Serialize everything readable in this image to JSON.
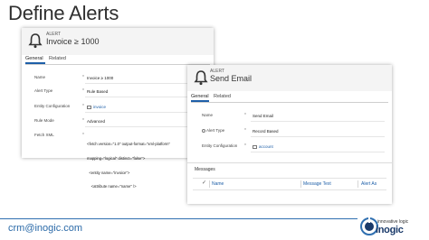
{
  "slide": {
    "title": "Define Alerts"
  },
  "form_a": {
    "entity": "ALERT",
    "record": "Invoice ≥ 1000",
    "tabs": [
      "General",
      "Related"
    ],
    "fields": [
      {
        "label": "Name",
        "required": "*",
        "value": "Invoice ≥ 1000"
      },
      {
        "label": "Alert Type",
        "required": "*",
        "value": "Rule Based"
      },
      {
        "label": "Entity Configuration",
        "required": "*",
        "value": "invoice"
      },
      {
        "label": "Rule Mode",
        "required": "*",
        "value": "Advanced"
      },
      {
        "label": "Fetch XML",
        "required": "*",
        "value": ""
      }
    ],
    "fetch_xml": [
      "<fetch version=\"1.0\" output-format=\"xml-platform\"",
      "mapping=\"logical\" distinct=\"false\">",
      "  <entity name=\"invoice\">",
      "    <attribute name=\"name\" />"
    ]
  },
  "form_b": {
    "entity": "ALERT",
    "record": "Send Email",
    "tabs": [
      "General",
      "Related"
    ],
    "fields": [
      {
        "label": "Name",
        "required": "*",
        "value": "Send Email"
      },
      {
        "label": "Alert Type",
        "required": "*",
        "value": "Record Based"
      },
      {
        "label": "Entity Configuration",
        "required": "*",
        "value": "account"
      }
    ],
    "messages": {
      "title": "Messages",
      "columns": [
        "Name",
        "Message Text",
        "Alert As"
      ]
    }
  },
  "footer": {
    "email": "crm@inogic.com",
    "logo_tagline": "innovative logic",
    "logo_brand": "inogic"
  },
  "colors": {
    "accent": "#1e5fa8",
    "footer_text": "#2b6aa8"
  },
  "icons": [
    "bell-icon",
    "lookup-icon",
    "alert-type-icon",
    "checkbox-icon",
    "inogic-logo"
  ]
}
